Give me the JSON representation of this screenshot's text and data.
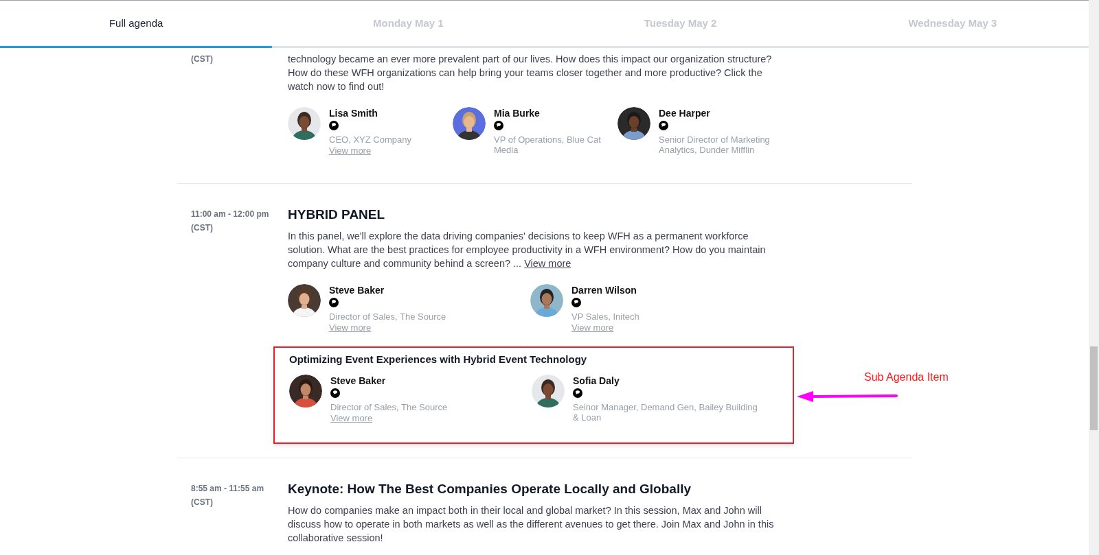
{
  "tabs": [
    {
      "label": "Full agenda",
      "selected": true
    },
    {
      "label": "Monday May 1",
      "selected": false
    },
    {
      "label": "Tuesday May 2",
      "selected": false
    },
    {
      "label": "Wednesday May 3",
      "selected": false
    }
  ],
  "sessions": [
    {
      "timezone": "(CST)",
      "description": "technology became an ever more prevalent part of our lives. How does this impact our organization structure? How do these WFH organizations can help bring your teams closer together and more productive? Click the watch now to find out!",
      "speakers": [
        {
          "name": "Lisa Smith",
          "role": "CEO, XYZ Company",
          "link": "View more"
        },
        {
          "name": "Mia Burke",
          "role": "VP of Operations, Blue Cat Media"
        },
        {
          "name": "Dee Harper",
          "role": "Senior Director of Marketing Analytics, Dunder Mifflin"
        }
      ]
    },
    {
      "time": "11:00 am - 12:00 pm",
      "timezone": "(CST)",
      "title": "HYBRID PANEL",
      "description": "In this panel, we'll explore the data driving companies' decisions to keep WFH as a permanent workforce solution. What are the best practices for employee productivity in a WFH environment? How do you maintain company culture and community behind a screen? ...",
      "description_link": "View more",
      "speakers": [
        {
          "name": "Steve Baker",
          "role": "Director of Sales, The Source",
          "link": "View more"
        },
        {
          "name": "Darren Wilson",
          "role": "VP Sales, Initech",
          "link": "View more"
        }
      ],
      "sub_items": [
        {
          "title": "Optimizing Event Experiences with Hybrid Event Technology",
          "highlighted": true,
          "speakers": [
            {
              "name": "Steve Baker",
              "role": "Director of Sales, The Source",
              "link": "View more"
            },
            {
              "name": "Sofia Daly",
              "role": "Seinor Manager, Demand Gen, Bailey Building & Loan"
            }
          ]
        }
      ]
    },
    {
      "time": "8:55 am - 11:55 am",
      "timezone": "(CST)",
      "title": "Keynote: How The Best Companies Operate Locally and Globally",
      "description": "How do companies make an impact both in their local and global market? In this session, Max and John will discuss how to operate in both markets as well as the different avenues to get there. Join Max and John in this collaborative session!"
    }
  ],
  "annotation": {
    "label": "Sub Agenda Item"
  }
}
